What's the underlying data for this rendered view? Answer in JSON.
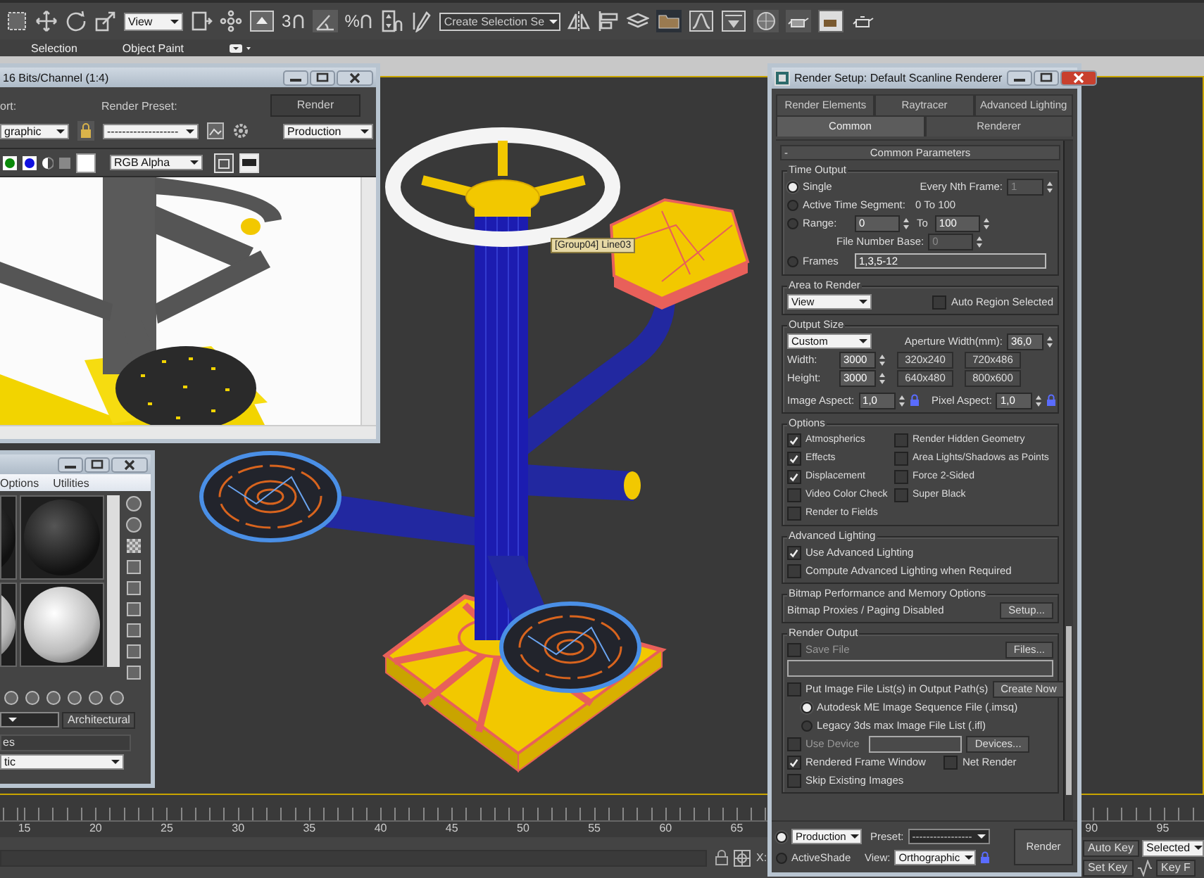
{
  "toolbar": {
    "view_dropdown": "View",
    "snap_glyphs": [
      "3",
      "%"
    ],
    "selection_set_dropdown": "Create Selection Se"
  },
  "ribbon_tabs": [
    {
      "label": "Selection"
    },
    {
      "label": "Object Paint"
    }
  ],
  "viewport": {
    "tooltip": "[Group04] Line03"
  },
  "frame_window": {
    "title": "16 Bits/Channel (1:4)",
    "viewport_label": "ort:",
    "viewport_value": "graphic",
    "preset_label": "Render Preset:",
    "preset_value": "-------------------",
    "render_button": "Render",
    "mode_value": "Production",
    "channel_value": "RGB Alpha"
  },
  "material_editor": {
    "menu": [
      "Options",
      "Utilities"
    ],
    "type_button": "Architectural",
    "rollout_label": "es",
    "dropdown_value": "tic"
  },
  "timeline": {
    "ticks": [
      "15",
      "20",
      "25",
      "30",
      "35",
      "40",
      "45",
      "50",
      "55",
      "60",
      "65"
    ],
    "right_ticks": [
      "90",
      "95"
    ]
  },
  "status": {
    "coord_label": "X:",
    "auto_key": "Auto Key",
    "key_mode_value": "Selected",
    "set_key": "Set Key",
    "key_filters": "Key F"
  },
  "render_setup": {
    "title": "Render Setup: Default Scanline Renderer",
    "tab_rows": [
      [
        {
          "label": "Render Elements",
          "selected": false
        },
        {
          "label": "Raytracer",
          "selected": false
        },
        {
          "label": "Advanced Lighting",
          "selected": false
        }
      ],
      [
        {
          "label": "Common",
          "selected": true
        },
        {
          "label": "Renderer",
          "selected": false
        }
      ]
    ],
    "rollout_toggle": "-",
    "rollout_title": "Common Parameters",
    "time_output": {
      "label": "Time Output",
      "rows": [
        {
          "kind": "single",
          "label": "Single",
          "selected": true,
          "side_label": "Every Nth Frame:",
          "side_value": "1",
          "side_disabled": true
        },
        {
          "kind": "active",
          "label": "Active Time Segment:",
          "selected": false,
          "text": "0 To 100"
        },
        {
          "kind": "range",
          "label": "Range:",
          "selected": false,
          "from": "0",
          "to_label": "To",
          "to": "100"
        },
        {
          "kind": "base",
          "label": "File Number Base:",
          "value": "0",
          "disabled": true
        },
        {
          "kind": "frames",
          "label": "Frames",
          "selected": false,
          "value": "1,3,5-12"
        }
      ]
    },
    "area_to_render": {
      "label": "Area to Render",
      "dropdown": "View",
      "checkbox": {
        "label": "Auto Region Selected",
        "checked": false
      }
    },
    "output_size": {
      "label": "Output Size",
      "dropdown": "Custom",
      "aperture_label": "Aperture Width(mm):",
      "aperture_value": "36,0",
      "width_label": "Width:",
      "width_value": "3000",
      "height_label": "Height:",
      "height_value": "3000",
      "presets": [
        "320x240",
        "720x486",
        "640x480",
        "800x600"
      ],
      "image_aspect_label": "Image Aspect:",
      "image_aspect_value": "1,0",
      "pixel_aspect_label": "Pixel Aspect:",
      "pixel_aspect_value": "1,0"
    },
    "options": {
      "label": "Options",
      "checkboxes": [
        {
          "label": "Atmospherics",
          "checked": true
        },
        {
          "label": "Render Hidden Geometry",
          "checked": false
        },
        {
          "label": "Effects",
          "checked": true
        },
        {
          "label": "Area Lights/Shadows as Points",
          "checked": false
        },
        {
          "label": "Displacement",
          "checked": true
        },
        {
          "label": "Force 2-Sided",
          "checked": false
        },
        {
          "label": "Video Color Check",
          "checked": false
        },
        {
          "label": "Super Black",
          "checked": false
        },
        {
          "label": "Render to Fields",
          "checked": false
        }
      ]
    },
    "advanced_lighting": {
      "label": "Advanced Lighting",
      "checkboxes": [
        {
          "label": "Use Advanced Lighting",
          "checked": true
        },
        {
          "label": "Compute Advanced Lighting when Required",
          "checked": false
        }
      ]
    },
    "bitmap": {
      "label": "Bitmap Performance and Memory Options",
      "status": "Bitmap Proxies / Paging Disabled",
      "button": "Setup..."
    },
    "render_output": {
      "label": "Render Output",
      "save_file": {
        "label": "Save File",
        "checked": false
      },
      "files_button": "Files...",
      "put_list": {
        "label": "Put Image File List(s) in Output Path(s)",
        "checked": false
      },
      "create_button": "Create Now",
      "list_formats": [
        {
          "label": "Autodesk ME Image Sequence File (.imsq)",
          "selected": true
        },
        {
          "label": "Legacy 3ds max Image File List (.ifl)",
          "selected": false
        }
      ],
      "use_device": {
        "label": "Use Device",
        "checked": false
      },
      "devices_button": "Devices...",
      "frame_options": [
        {
          "label": "Rendered Frame Window",
          "checked": true
        },
        {
          "label": "Net Render",
          "checked": false
        },
        {
          "label": "Skip Existing Images",
          "checked": false
        }
      ]
    },
    "footer": {
      "modes": [
        {
          "selected": true
        },
        {
          "label": "ActiveShade",
          "selected": false
        }
      ],
      "mode_dropdown": "Production",
      "preset_label": "Preset:",
      "preset_value": "-----------------",
      "view_label": "View:",
      "view_value": "Orthographic",
      "render_button": "Render"
    }
  }
}
